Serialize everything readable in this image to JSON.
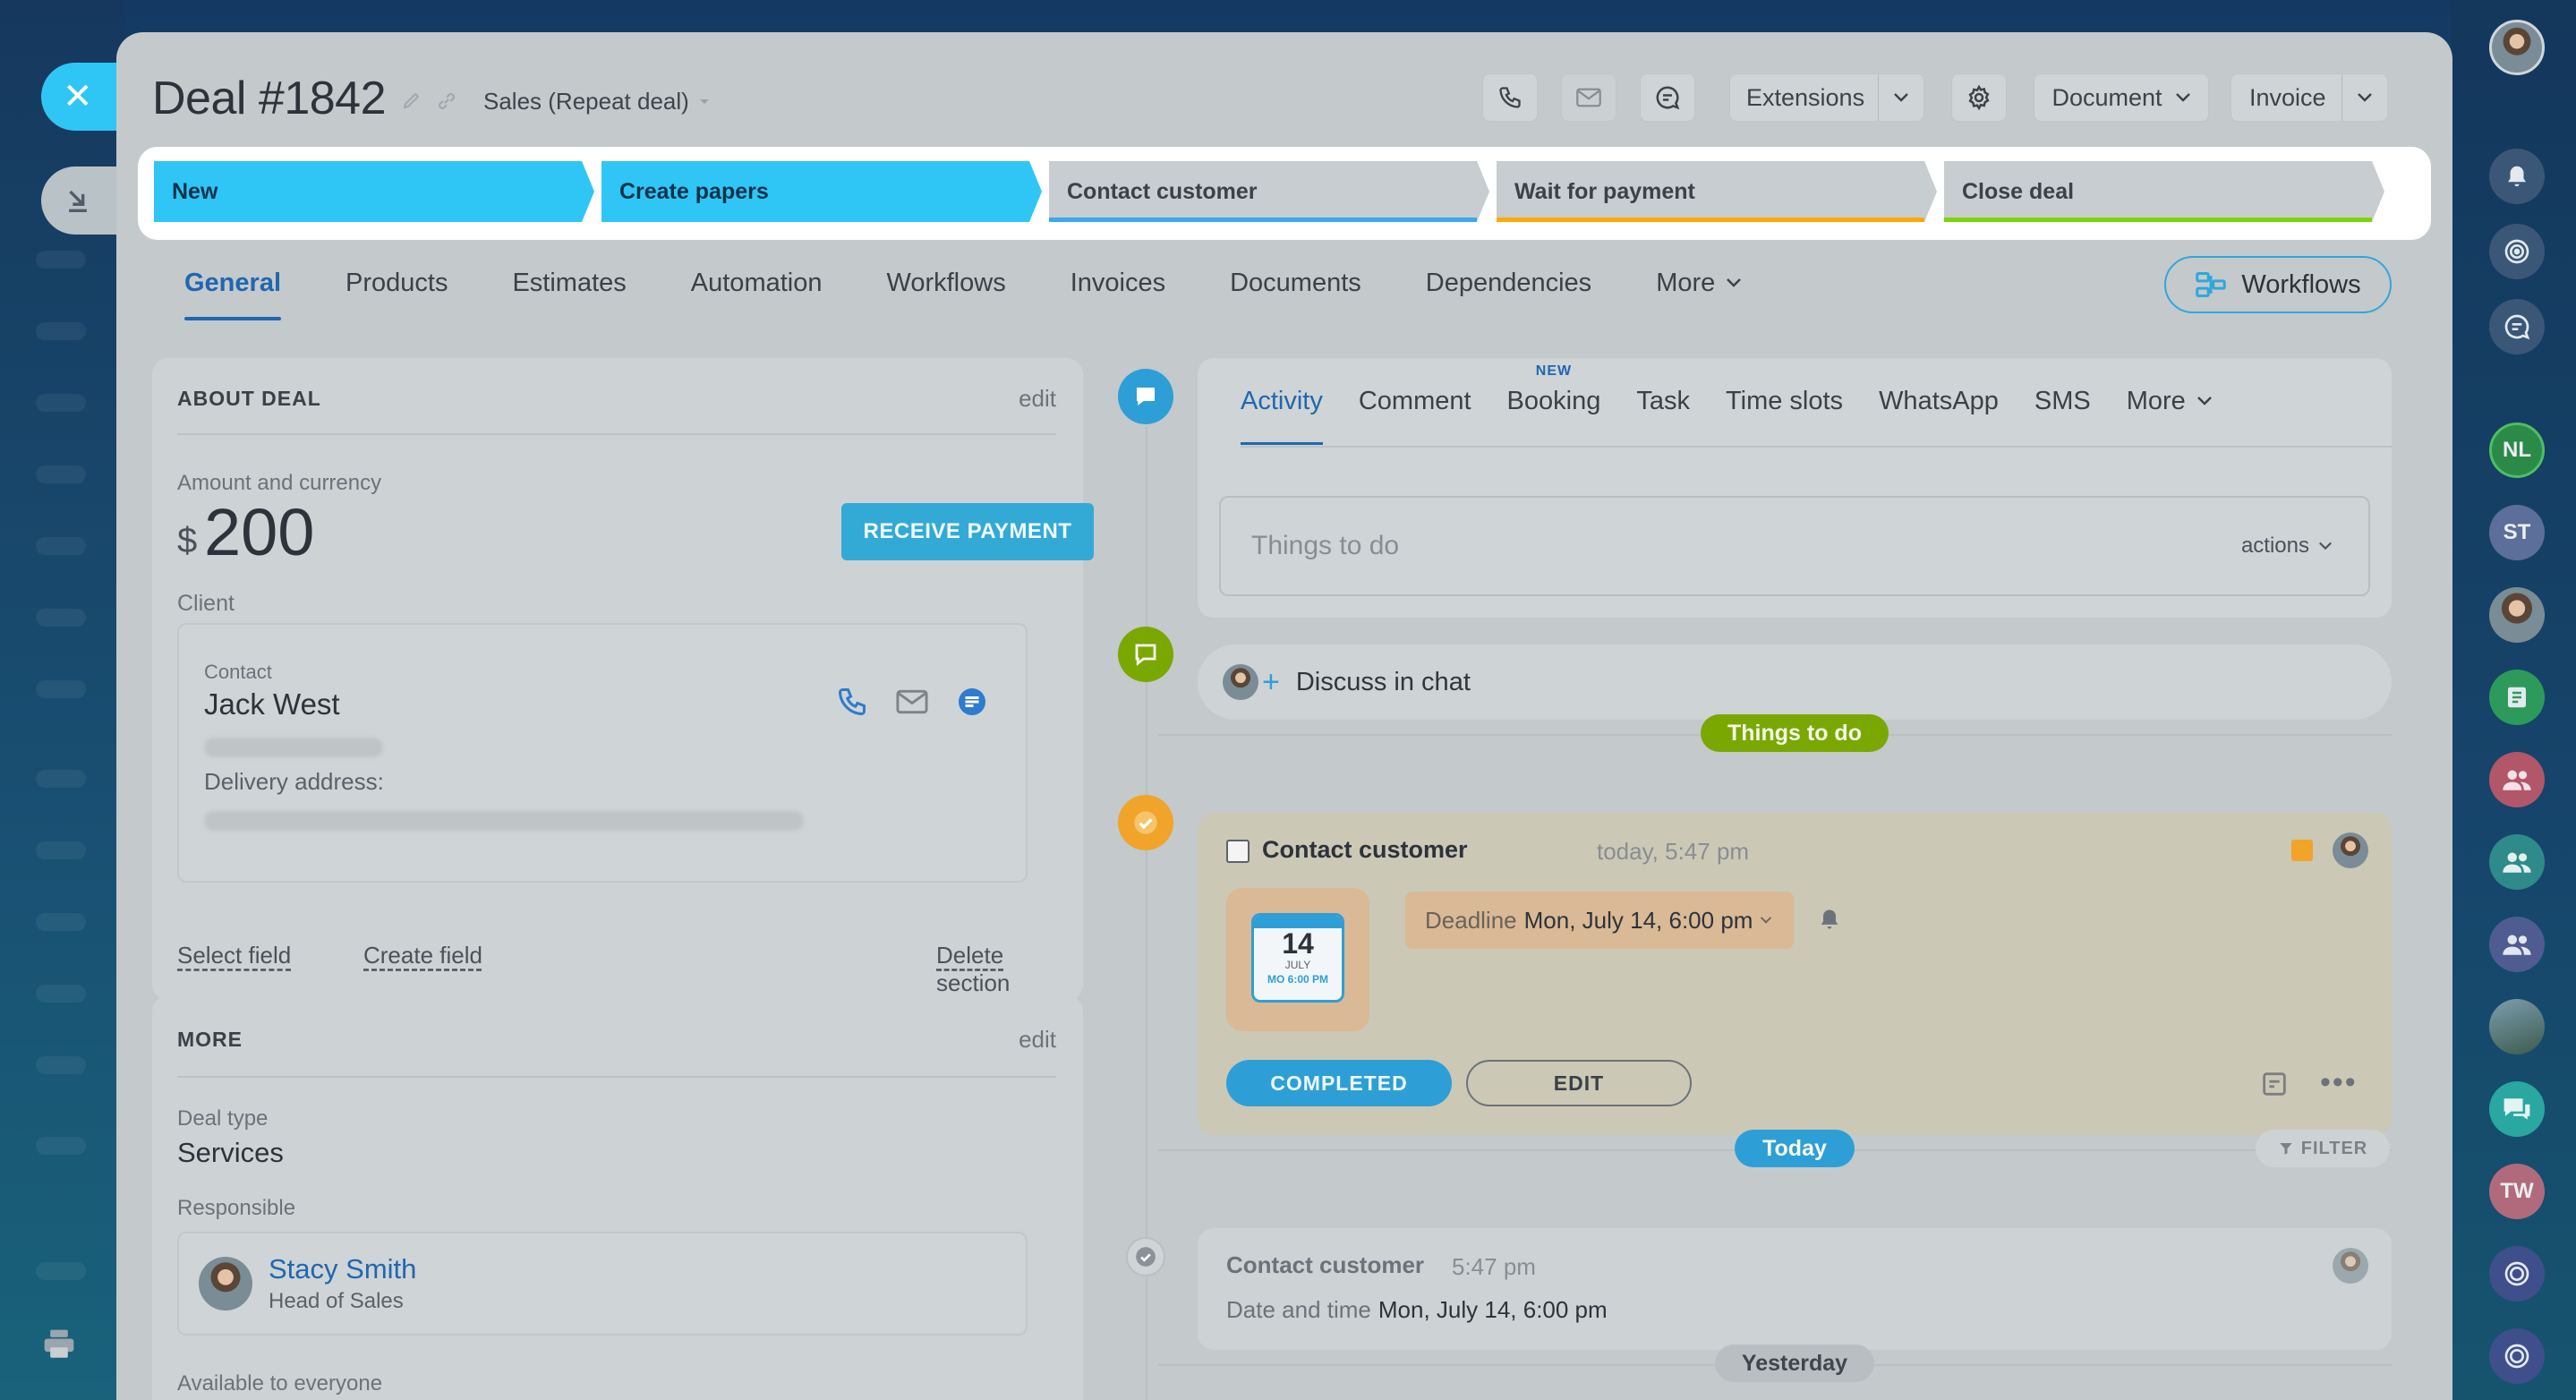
{
  "deal": {
    "title": "Deal #1842",
    "pipeline": "Sales (Repeat deal)"
  },
  "header_buttons": {
    "extensions": "Extensions",
    "document": "Document",
    "invoice": "Invoice"
  },
  "stages": [
    {
      "label": "New",
      "state": "active",
      "color": "#2fc6f6"
    },
    {
      "label": "Create papers",
      "state": "active",
      "color": "#2fc6f6"
    },
    {
      "label": "Contact customer",
      "state": "inactive",
      "color": "#39a8ef"
    },
    {
      "label": "Wait for payment",
      "state": "inactive",
      "color": "#ffa900"
    },
    {
      "label": "Close deal",
      "state": "inactive",
      "color": "#7bd500"
    }
  ],
  "tabs": [
    "General",
    "Products",
    "Estimates",
    "Automation",
    "Workflows",
    "Invoices",
    "Documents",
    "Dependencies",
    "More"
  ],
  "workflows_button": "Workflows",
  "about_deal": {
    "title": "ABOUT DEAL",
    "edit": "edit",
    "amount_label": "Amount and currency",
    "currency_symbol": "$",
    "amount": "200",
    "receive_payment": "RECEIVE PAYMENT",
    "client_label": "Client",
    "contact_label": "Contact",
    "contact_name": "Jack West",
    "delivery_label": "Delivery address:",
    "select_field": "Select field",
    "create_field": "Create field",
    "delete_section": "Delete section"
  },
  "more_section": {
    "title": "MORE",
    "edit": "edit",
    "deal_type_label": "Deal type",
    "deal_type": "Services",
    "responsible_label": "Responsible",
    "responsible_name": "Stacy Smith",
    "responsible_role": "Head of Sales",
    "available": "Available to everyone"
  },
  "activity": {
    "tabs": [
      "Activity",
      "Comment",
      "Booking",
      "Task",
      "Time slots",
      "WhatsApp",
      "SMS",
      "More"
    ],
    "new_badge": "NEW",
    "placeholder": "Things to do",
    "actions": "actions"
  },
  "chat": {
    "label": "Discuss in chat"
  },
  "timeline": {
    "things_to_do": "Things to do",
    "today": "Today",
    "yesterday": "Yesterday",
    "filter": "FILTER"
  },
  "task": {
    "title": "Contact customer",
    "time": "today, 5:47 pm",
    "deadline_label": "Deadline",
    "deadline_value": "Mon, July 14, 6:00 pm",
    "cal_day": "14",
    "cal_month": "JULY",
    "cal_time": "MO 6:00 PM",
    "completed": "COMPLETED",
    "edit": "EDIT"
  },
  "done": {
    "title": "Contact customer",
    "time": "5:47 pm",
    "date_label": "Date and time",
    "date_value": "Mon, July 14, 6:00 pm"
  },
  "right_bar": {
    "nl": "NL",
    "st": "ST",
    "tw": "TW"
  },
  "colors": {
    "accent": "#2fc6f6",
    "link": "#2067b0",
    "chat_green": "#7aa800",
    "task_orange": "#f0a42a"
  }
}
